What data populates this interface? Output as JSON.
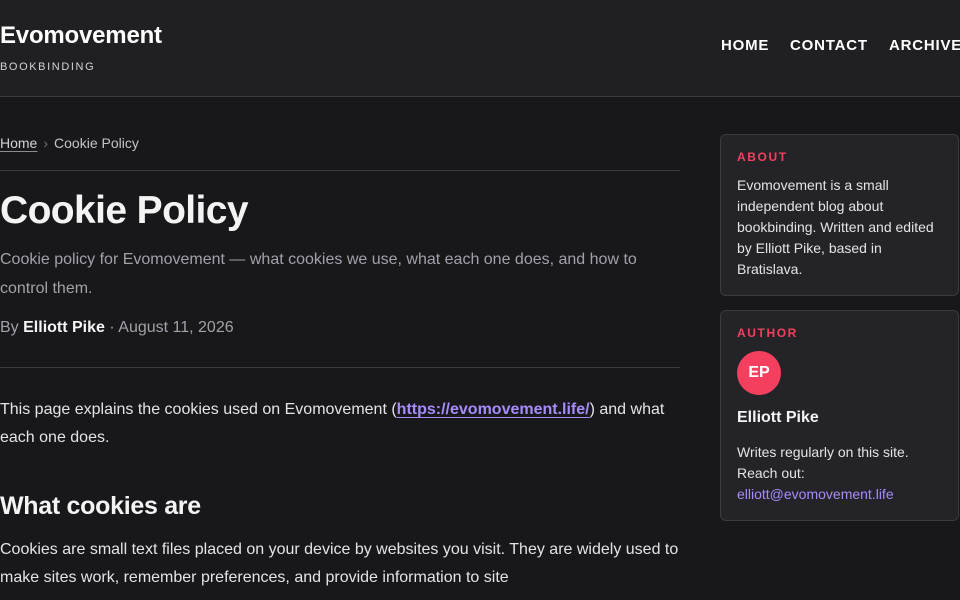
{
  "site": {
    "title": "Evomovement",
    "subtitle": "BOOKBINDING"
  },
  "nav": {
    "items": [
      "HOME",
      "CONTACT",
      "ARCHIVE"
    ]
  },
  "breadcrumb": {
    "home": "Home",
    "separator": "›",
    "current": "Cookie Policy"
  },
  "article": {
    "title": "Cookie Policy",
    "lede": "Cookie policy for Evomovement — what cookies we use, what each one does, and how to control them.",
    "byline_prefix": "By",
    "author": "Elliott Pike",
    "byline_sep": "·",
    "date": "August 11, 2026",
    "intro_before": "This page explains the cookies used on Evomovement (",
    "intro_link": "https://evomovement.life/",
    "intro_after": ") and what each one does.",
    "section_heading": "What cookies are",
    "section_text": "Cookies are small text files placed on your device by websites you visit. They are widely used to make sites work, remember preferences, and provide information to site"
  },
  "sidebar": {
    "about": {
      "label": "ABOUT",
      "text": "Evomovement is a small independent blog about bookbinding. Written and edited by Elliott Pike, based in Bratislava."
    },
    "author": {
      "label": "AUTHOR",
      "initials": "EP",
      "name": "Elliott Pike",
      "bio": "Writes regularly on this site. Reach out:",
      "email": "elliott@evomovement.life"
    }
  },
  "colors": {
    "accent": "#f43f5e",
    "link": "#a78bfa",
    "background": "#18181b",
    "header": "#202023"
  }
}
